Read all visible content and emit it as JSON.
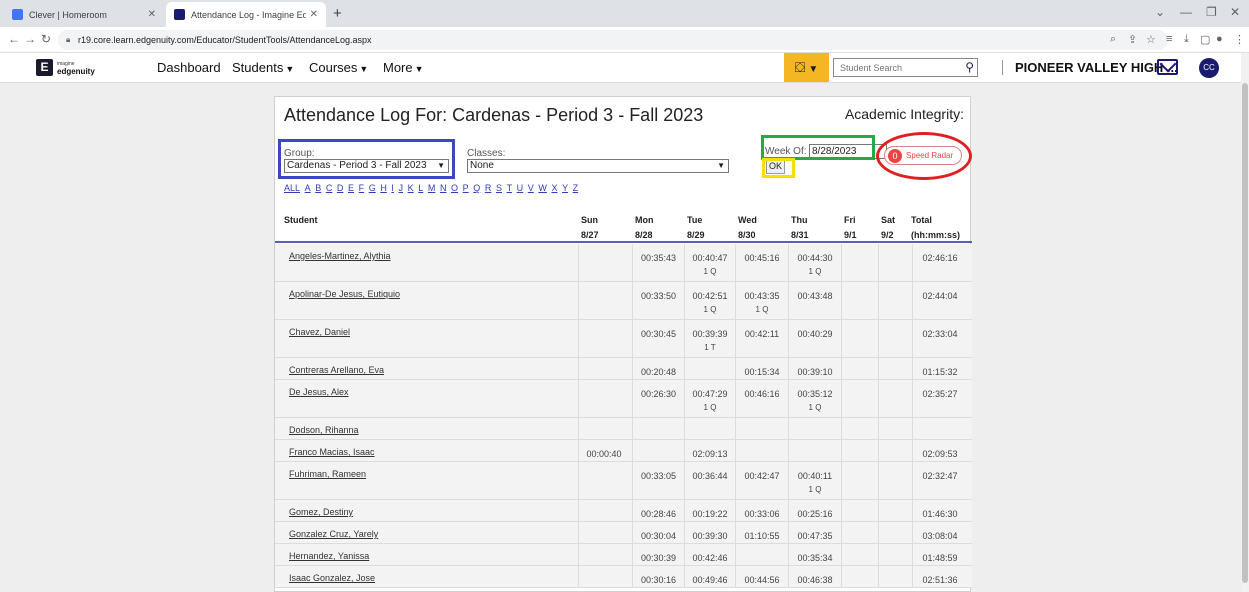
{
  "browser": {
    "tabs": [
      {
        "label": "Clever | Homeroom",
        "favicon_color": "#4274f6"
      },
      {
        "label": "Attendance Log - Imagine Edger",
        "favicon_color": "#1a1a6e"
      }
    ],
    "new_tab": "+",
    "url": "r19.core.learn.edgenuity.com/Educator/StudentTools/AttendanceLog.aspx"
  },
  "header": {
    "logo_small": "imagine",
    "logo_main": "edgenuity",
    "nav": [
      {
        "label": "Dashboard"
      },
      {
        "label": "Students"
      },
      {
        "label": "Courses"
      },
      {
        "label": "More"
      }
    ],
    "search_placeholder": "Student Search",
    "school": "PIONEER VALLEY HIGH ...",
    "avatar": "CC"
  },
  "page": {
    "title": "Attendance Log For: Cardenas - Period 3 - Fall 2023",
    "integrity_label": "Academic Integrity:",
    "group_label": "Group:",
    "group_value": "Cardenas - Period 3 - Fall 2023",
    "classes_label": "Classes:",
    "classes_value": "None",
    "week_label": "Week Of:",
    "week_value": "8/28/2023",
    "ok_label": "OK",
    "speed_radar_count": "0",
    "speed_radar_label": "Speed Radar",
    "letters": [
      "ALL",
      "A",
      "B",
      "C",
      "D",
      "E",
      "F",
      "G",
      "H",
      "I",
      "J",
      "K",
      "L",
      "M",
      "N",
      "O",
      "P",
      "Q",
      "R",
      "S",
      "T",
      "U",
      "V",
      "W",
      "X",
      "Y",
      "Z"
    ]
  },
  "table": {
    "student_header": "Student",
    "columns": [
      {
        "day": "Sun",
        "date": "8/27"
      },
      {
        "day": "Mon",
        "date": "8/28"
      },
      {
        "day": "Tue",
        "date": "8/29"
      },
      {
        "day": "Wed",
        "date": "8/30"
      },
      {
        "day": "Thu",
        "date": "8/31"
      },
      {
        "day": "Fri",
        "date": "9/1"
      },
      {
        "day": "Sat",
        "date": "9/2"
      }
    ],
    "total_header": "Total",
    "total_sub": "(hh:mm:ss)",
    "rows": [
      {
        "name": "Angeles-Martinez, Alythia",
        "days": [
          [
            "",
            ""
          ],
          [
            "00:35:43",
            ""
          ],
          [
            "00:40:47",
            "1 Q"
          ],
          [
            "00:45:16",
            ""
          ],
          [
            "00:44:30",
            "1 Q"
          ],
          [
            "",
            ""
          ],
          [
            "",
            ""
          ]
        ],
        "total": "02:46:16"
      },
      {
        "name": "Apolinar-De Jesus, Eutiquio",
        "days": [
          [
            "",
            ""
          ],
          [
            "00:33:50",
            ""
          ],
          [
            "00:42:51",
            "1 Q"
          ],
          [
            "00:43:35",
            "1 Q"
          ],
          [
            "00:43:48",
            ""
          ],
          [
            "",
            ""
          ],
          [
            "",
            ""
          ]
        ],
        "total": "02:44:04"
      },
      {
        "name": "Chavez, Daniel",
        "days": [
          [
            "",
            ""
          ],
          [
            "00:30:45",
            ""
          ],
          [
            "00:39:39",
            "1 T"
          ],
          [
            "00:42:11",
            ""
          ],
          [
            "00:40:29",
            ""
          ],
          [
            "",
            ""
          ],
          [
            "",
            ""
          ]
        ],
        "total": "02:33:04"
      },
      {
        "name": "Contreras Arellano, Eva",
        "days": [
          [
            "",
            ""
          ],
          [
            "00:20:48",
            ""
          ],
          [
            "",
            ""
          ],
          [
            "00:15:34",
            ""
          ],
          [
            "00:39:10",
            ""
          ],
          [
            "",
            ""
          ],
          [
            "",
            ""
          ]
        ],
        "total": "01:15:32"
      },
      {
        "name": "De Jesus, Alex",
        "days": [
          [
            "",
            ""
          ],
          [
            "00:26:30",
            ""
          ],
          [
            "00:47:29",
            "1 Q"
          ],
          [
            "00:46:16",
            ""
          ],
          [
            "00:35:12",
            "1 Q"
          ],
          [
            "",
            ""
          ],
          [
            "",
            ""
          ]
        ],
        "total": "02:35:27"
      },
      {
        "name": "Dodson, Rihanna",
        "days": [
          [
            "",
            ""
          ],
          [
            "",
            ""
          ],
          [
            "",
            ""
          ],
          [
            "",
            ""
          ],
          [
            "",
            ""
          ],
          [
            "",
            ""
          ],
          [
            "",
            ""
          ]
        ],
        "total": ""
      },
      {
        "name": "Franco Macias, Isaac",
        "days": [
          [
            "00:00:40",
            ""
          ],
          [
            "",
            ""
          ],
          [
            "02:09:13",
            ""
          ],
          [
            "",
            ""
          ],
          [
            "",
            ""
          ],
          [
            "",
            ""
          ],
          [
            "",
            ""
          ]
        ],
        "total": "02:09:53"
      },
      {
        "name": "Fuhriman, Rameen",
        "days": [
          [
            "",
            ""
          ],
          [
            "00:33:05",
            ""
          ],
          [
            "00:36:44",
            ""
          ],
          [
            "00:42:47",
            ""
          ],
          [
            "00:40:11",
            "1 Q"
          ],
          [
            "",
            ""
          ],
          [
            "",
            ""
          ]
        ],
        "total": "02:32:47"
      },
      {
        "name": "Gomez, Destiny",
        "days": [
          [
            "",
            ""
          ],
          [
            "00:28:46",
            ""
          ],
          [
            "00:19:22",
            ""
          ],
          [
            "00:33:06",
            ""
          ],
          [
            "00:25:16",
            ""
          ],
          [
            "",
            ""
          ],
          [
            "",
            ""
          ]
        ],
        "total": "01:46:30"
      },
      {
        "name": "Gonzalez Cruz, Yarely",
        "days": [
          [
            "",
            ""
          ],
          [
            "00:30:04",
            ""
          ],
          [
            "00:39:30",
            ""
          ],
          [
            "01:10:55",
            ""
          ],
          [
            "00:47:35",
            ""
          ],
          [
            "",
            ""
          ],
          [
            "",
            ""
          ]
        ],
        "total": "03:08:04"
      },
      {
        "name": "Hernandez, Yanissa",
        "days": [
          [
            "",
            ""
          ],
          [
            "00:30:39",
            ""
          ],
          [
            "00:42:46",
            ""
          ],
          [
            "",
            ""
          ],
          [
            "00:35:34",
            ""
          ],
          [
            "",
            ""
          ],
          [
            "",
            ""
          ]
        ],
        "total": "01:48:59"
      },
      {
        "name": "Isaac Gonzalez, Jose",
        "days": [
          [
            "",
            ""
          ],
          [
            "00:30:16",
            ""
          ],
          [
            "00:49:46",
            ""
          ],
          [
            "00:44:56",
            ""
          ],
          [
            "00:46:38",
            ""
          ],
          [
            "",
            ""
          ],
          [
            "",
            ""
          ]
        ],
        "total": "02:51:36"
      }
    ]
  }
}
